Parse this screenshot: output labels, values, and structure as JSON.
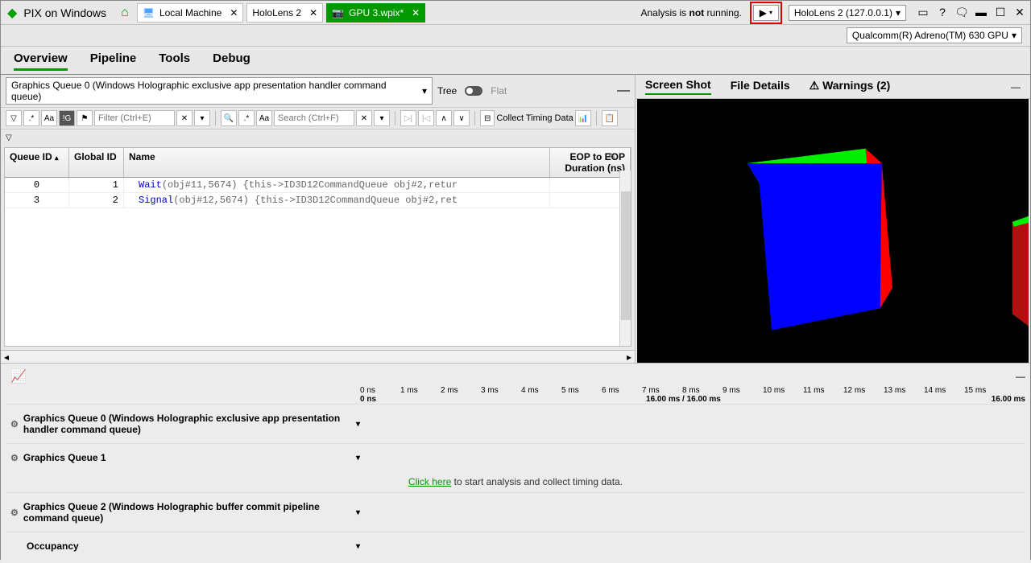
{
  "title": "PIX on Windows",
  "tabs": [
    {
      "label": "Local Machine",
      "iconColor": "#4aa3ff"
    },
    {
      "label": "HoloLens 2",
      "iconColor": "#4aa3ff"
    },
    {
      "label": "GPU 3.wpix*",
      "iconColor": "#fff",
      "active": true,
      "camera": true
    }
  ],
  "status": {
    "prefix": "Analysis is ",
    "bold": "not",
    "suffix": " running."
  },
  "deviceDropdown": "HoloLens 2 (127.0.0.1)",
  "gpuDropdown": "Qualcomm(R) Adreno(TM) 630 GPU",
  "mainTabs": [
    "Overview",
    "Pipeline",
    "Tools",
    "Debug"
  ],
  "queueDropdown": "Graphics Queue 0 (Windows Holographic exclusive app presentation handler command queue)",
  "treeLabel": "Tree",
  "flatLabel": "Flat",
  "filter1": {
    "placeholder": "Filter (Ctrl+E)"
  },
  "filter2": {
    "placeholder": "Search (Ctrl+F)"
  },
  "collectTiming": "Collect Timing Data",
  "tableHeaders": {
    "queueId": "Queue ID",
    "globalId": "Global ID",
    "name": "Name",
    "eop": "EOP to EOP Duration (ns)"
  },
  "tableRows": [
    {
      "queueId": "0",
      "globalId": "1",
      "fn": "Wait",
      "args": "(obj#11,5674)  {this->ID3D12CommandQueue obj#2,retur"
    },
    {
      "queueId": "3",
      "globalId": "2",
      "fn": "Signal",
      "args": "(obj#12,5674)  {this->ID3D12CommandQueue obj#2,ret"
    }
  ],
  "rightTabs": [
    {
      "label": "Screen Shot",
      "active": true
    },
    {
      "label": "File Details"
    },
    {
      "label": "Warnings (2)",
      "warn": true
    }
  ],
  "timelineTicks": [
    "0 ns",
    "1 ms",
    "2 ms",
    "3 ms",
    "4 ms",
    "5 ms",
    "6 ms",
    "7 ms",
    "8 ms",
    "9 ms",
    "10 ms",
    "11 ms",
    "12 ms",
    "13 ms",
    "14 ms",
    "15 ms"
  ],
  "timelineSub": {
    "left": "0 ns",
    "mid": "16.00 ms / 16.00 ms",
    "right": "16.00 ms"
  },
  "queues": [
    "Graphics Queue 0 (Windows Holographic exclusive app presentation handler command queue)",
    "Graphics Queue 1",
    "Graphics Queue 2 (Windows Holographic buffer commit pipeline command queue)",
    "Occupancy"
  ],
  "analysisLink": "Click here",
  "analysisText": " to start analysis and collect timing data."
}
